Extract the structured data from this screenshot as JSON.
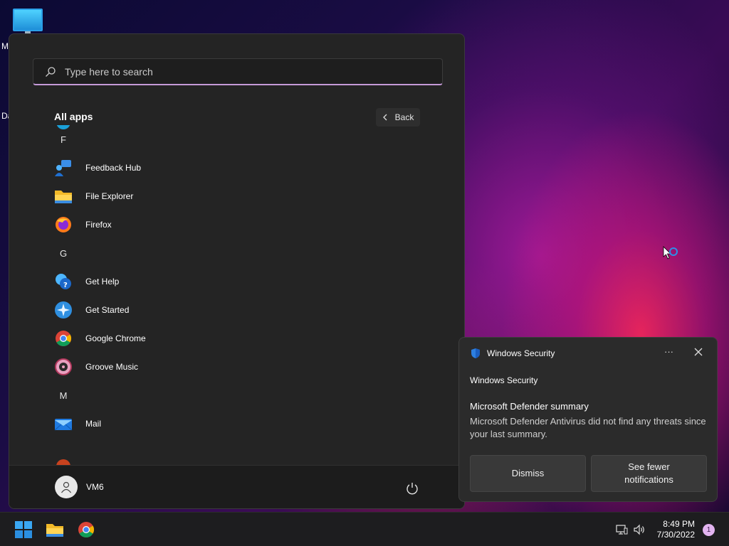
{
  "desktop": {
    "icon1_label": "M",
    "icon2_label": "Da"
  },
  "start_menu": {
    "search_placeholder": "Type here to search",
    "section_title": "All apps",
    "back_label": "Back",
    "apps": [
      {
        "type": "letter",
        "label": "F"
      },
      {
        "type": "app",
        "label": "Feedback Hub",
        "icon": "feedback-hub-icon"
      },
      {
        "type": "app",
        "label": "File Explorer",
        "icon": "file-explorer-icon"
      },
      {
        "type": "app",
        "label": "Firefox",
        "icon": "firefox-icon"
      },
      {
        "type": "letter",
        "label": "G"
      },
      {
        "type": "app",
        "label": "Get Help",
        "icon": "get-help-icon"
      },
      {
        "type": "app",
        "label": "Get Started",
        "icon": "get-started-icon"
      },
      {
        "type": "app",
        "label": "Google Chrome",
        "icon": "chrome-icon"
      },
      {
        "type": "app",
        "label": "Groove Music",
        "icon": "groove-music-icon"
      },
      {
        "type": "letter",
        "label": "M"
      },
      {
        "type": "app",
        "label": "Mail",
        "icon": "mail-icon"
      }
    ],
    "user_name": "VM6"
  },
  "notification": {
    "source": "Windows Security",
    "app_name": "Windows Security",
    "title": "Microsoft Defender summary",
    "body": "Microsoft Defender Antivirus did not find any threats since your last summary.",
    "dismiss_label": "Dismiss",
    "fewer_label_line1": "See fewer",
    "fewer_label_line2": "notifications"
  },
  "taskbar": {
    "time": "8:49 PM",
    "date": "7/30/2022",
    "notification_count": "1"
  },
  "colors": {
    "search_accent": "#c59ad8",
    "start_bg": "#242424",
    "toast_bg": "#2b2b2b",
    "badge_bg": "#e2b4f0"
  }
}
